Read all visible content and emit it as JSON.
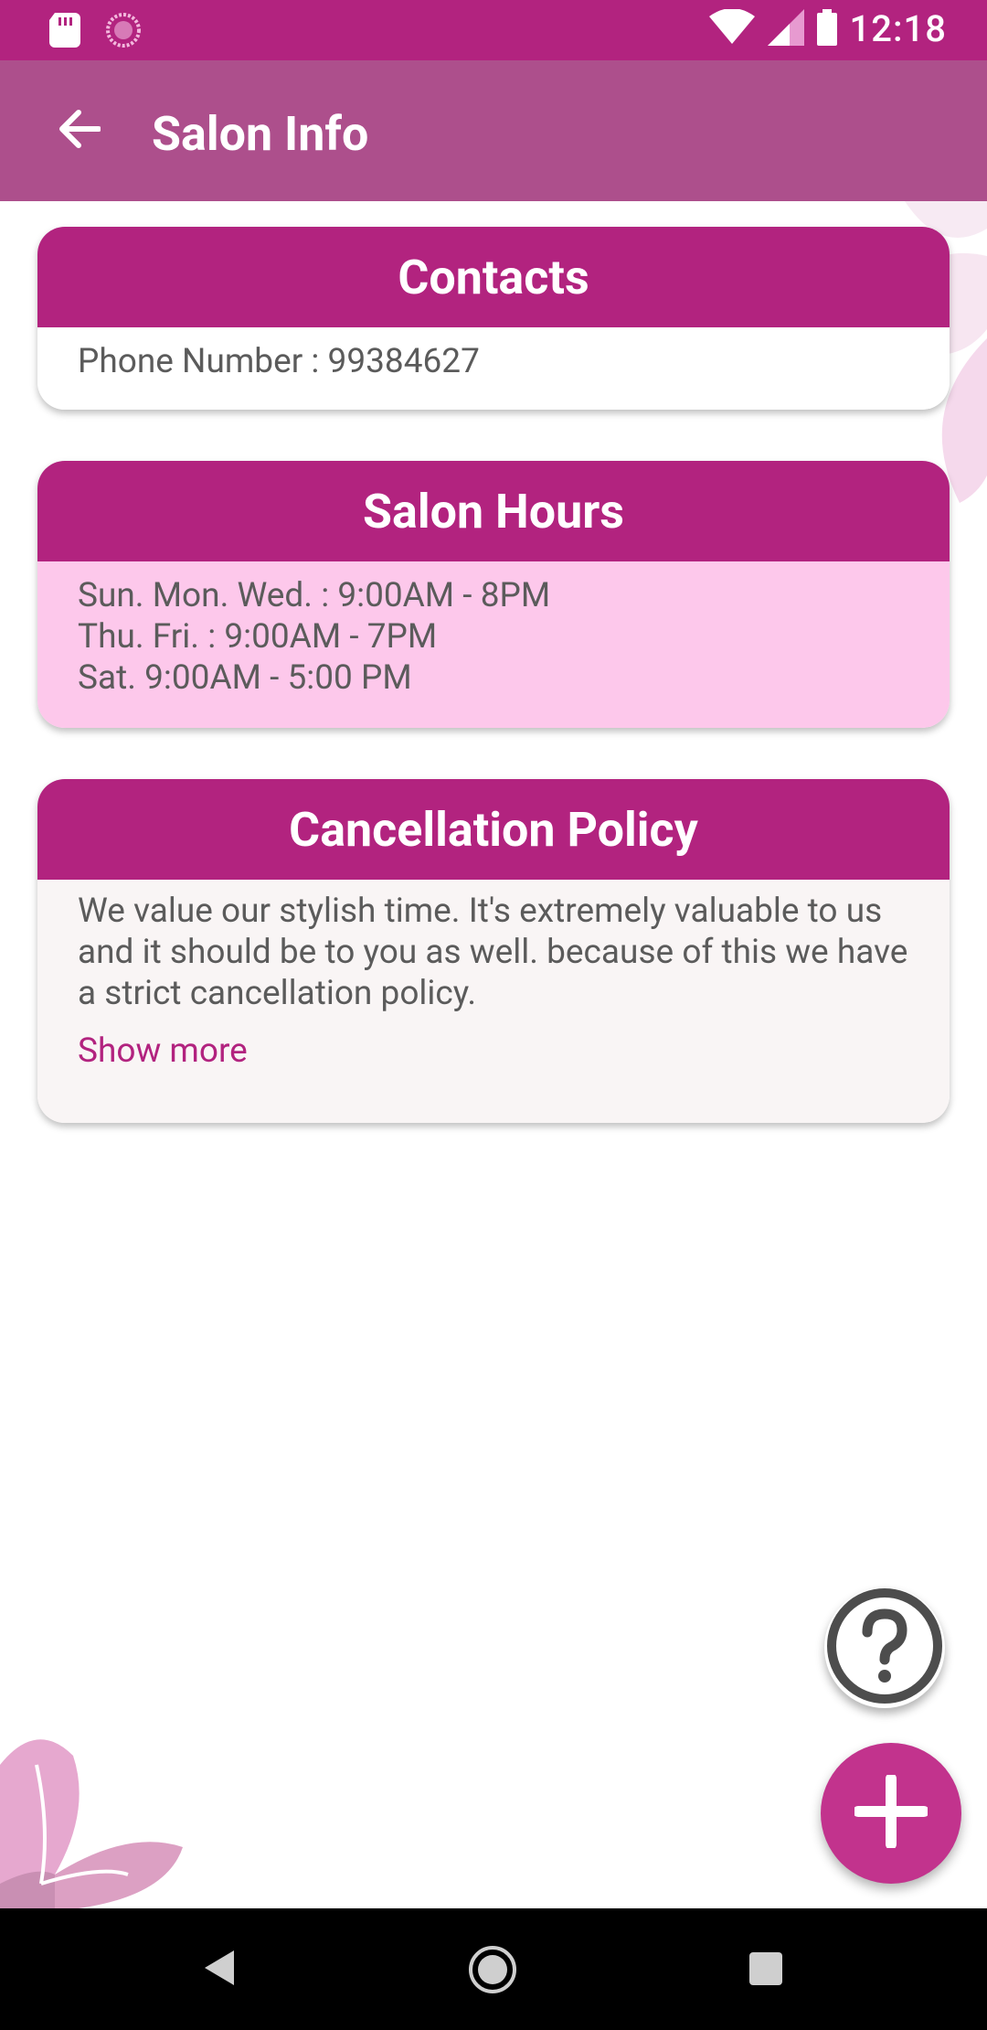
{
  "status_bar": {
    "time": "12:18"
  },
  "app_bar": {
    "title": "Salon Info"
  },
  "contacts": {
    "title": "Contacts",
    "phone": "Phone Number : 99384627"
  },
  "hours": {
    "title": "Salon Hours",
    "lines": [
      "Sun. Mon. Wed. : 9:00AM - 8PM",
      "Thu. Fri. : 9:00AM - 7PM",
      "Sat. 9:00AM - 5:00 PM"
    ]
  },
  "policy": {
    "title": "Cancellation Policy",
    "text": "We value our stylish time. It's extremely valuable to us and it should be to you as well. because of this we have a strict cancellation policy.",
    "show_more": "Show more"
  },
  "colors": {
    "primary": "#b2237f",
    "app_bar": "#ad4f8c",
    "hours_bg": "#fdc8eb",
    "fab": "#c2338d"
  },
  "icons": {
    "back": "arrow-left-icon",
    "help": "question-circle-icon",
    "add": "plus-icon"
  }
}
